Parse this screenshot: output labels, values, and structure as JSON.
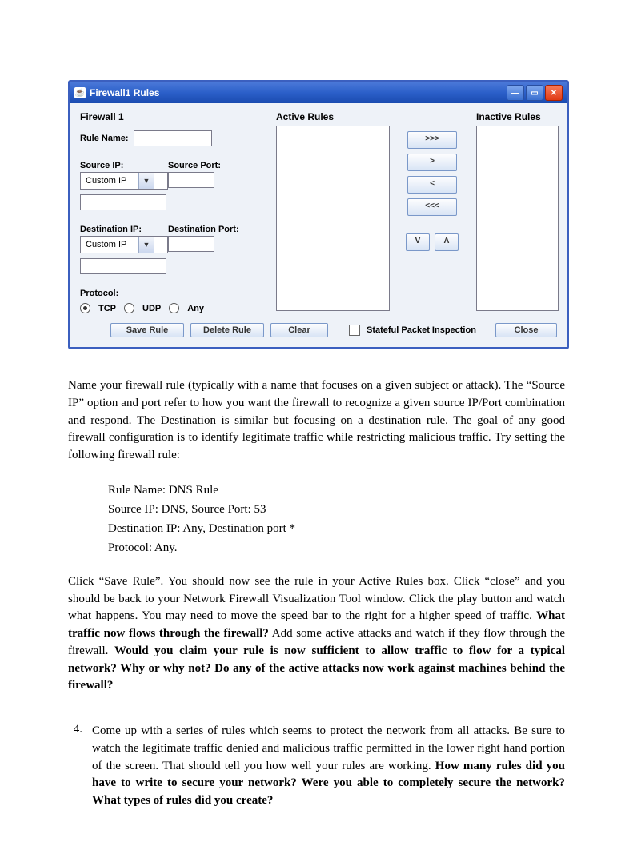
{
  "dialog": {
    "title": "Firewall1 Rules",
    "firewall_heading": "Firewall 1",
    "active_heading": "Active Rules",
    "inactive_heading": "Inactive Rules",
    "rule_name_label": "Rule Name:",
    "source_ip_label": "Source IP:",
    "source_port_label": "Source Port:",
    "dest_ip_label": "Destination IP:",
    "dest_port_label": "Destination Port:",
    "combo_src_value": "Custom IP",
    "combo_dst_value": "Custom IP",
    "protocol_label": "Protocol:",
    "proto_tcp": "TCP",
    "proto_udp": "UDP",
    "proto_any": "Any",
    "btn_move_all_right": ">>>",
    "btn_move_right": ">",
    "btn_move_left": "<",
    "btn_move_all_left": "<<<",
    "btn_down": "V",
    "btn_up": "Λ",
    "btn_save": "Save Rule",
    "btn_delete": "Delete Rule",
    "btn_clear": "Clear",
    "chk_spi": "Stateful Packet Inspection",
    "btn_close": "Close"
  },
  "doc": {
    "p1": "Name your firewall rule (typically with a name that focuses on a given subject or attack). The “Source IP” option and port refer to how you want the firewall to recognize a given source IP/Port combination and respond.  The Destination is similar but focusing on a destination rule.  The goal of any good firewall configuration is to identify legitimate traffic while restricting malicious traffic.   Try setting the following firewall rule:",
    "ex_rule_name": "Rule Name:  DNS Rule",
    "ex_source": "Source IP:  DNS,  Source Port: 53",
    "ex_dest": "Destination IP:  Any,  Destination port *",
    "ex_proto": "Protocol:  Any.",
    "p2a": "Click “Save Rule”.  You should now see the rule in your Active Rules box.  Click “close” and you should be back to your Network Firewall Visualization Tool window.  Click the play button and watch what happens. You may need to move the speed bar to the right for a higher speed of traffic. ",
    "p2b": "What traffic now flows through the firewall?",
    "p2c": "  Add some active attacks and watch if they flow through the firewall. ",
    "p2d": "Would you claim your rule is now sufficient to allow traffic to flow for a typical network?  Why or why not? Do any of the active attacks now work against machines behind the firewall?",
    "q4_num": "4.",
    "q4a": "Come up with a series of rules which seems to protect the network from all attacks.  Be sure to watch the legitimate traffic denied and malicious traffic permitted in the lower right hand portion of the screen.  That should tell you how well your rules are working.  ",
    "q4b": "How many rules did you have to write to secure your network?  Were you able to completely secure the network?  What types of rules did you create?"
  }
}
